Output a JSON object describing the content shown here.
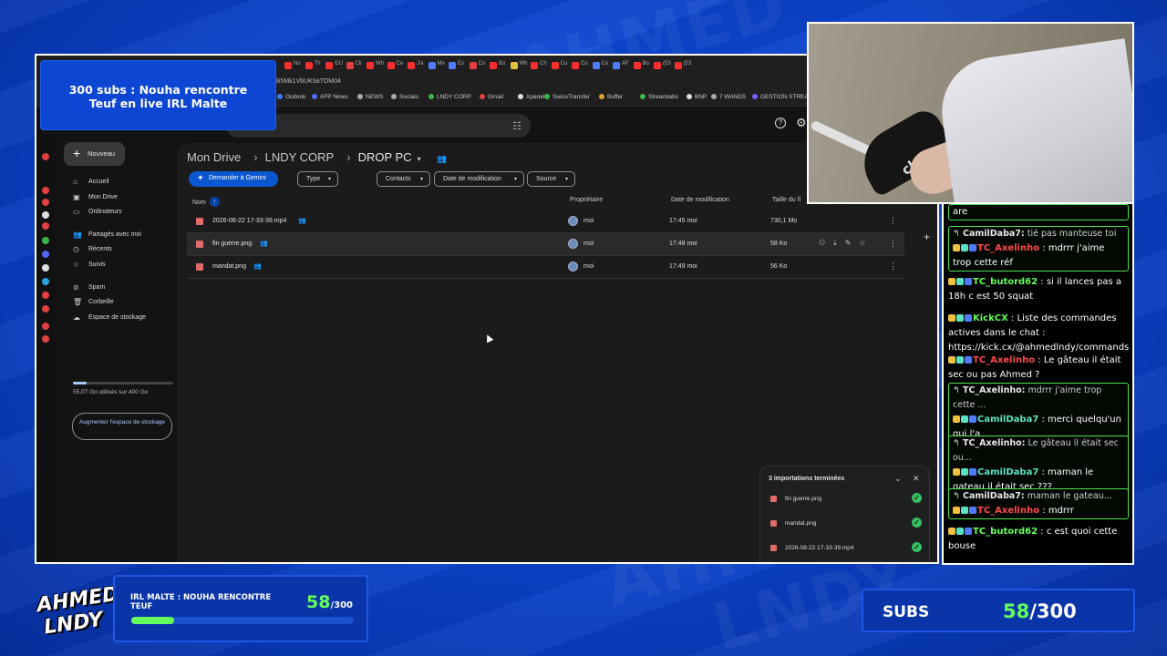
{
  "stream_title": "300 subs : Nouha rencontre Teuf en live IRL Malte",
  "browser": {
    "url_fragment": "8i5Mk1VbUK9aTOM04",
    "tabs": [
      "No",
      "Th",
      "GU",
      "Cli",
      "Wh",
      "Ce",
      "J'a",
      "Me",
      "Es",
      "Co",
      "Bo",
      "Wh",
      "Ch",
      "Cu",
      "Cu",
      "Co",
      "AF",
      "Bo",
      "(53",
      "(53"
    ],
    "bookmarks": [
      "Outlook",
      "AFP News",
      "NEWS",
      "Socials",
      "LNDY CORP",
      "Gmail",
      "Xpanel",
      "SwissTransfer",
      "Buffer",
      "Streamlabs",
      "BNP",
      "7 WANDS",
      "GESTION STREAM"
    ]
  },
  "drive": {
    "new_button": "Nouveau",
    "nav": [
      {
        "icon": "home-icon",
        "glyph": "⌂",
        "label": "Accueil"
      },
      {
        "icon": "drive-icon",
        "glyph": "▣",
        "label": "Mon Drive"
      },
      {
        "icon": "computer-icon",
        "glyph": "▭",
        "label": "Ordinateurs"
      },
      {
        "icon": "shared-icon",
        "glyph": "👥",
        "label": "Partagés avec moi"
      },
      {
        "icon": "recent-icon",
        "glyph": "◷",
        "label": "Récents"
      },
      {
        "icon": "star-icon",
        "glyph": "☆",
        "label": "Suivis"
      },
      {
        "icon": "spam-icon",
        "glyph": "⊘",
        "label": "Spam"
      },
      {
        "icon": "trash-icon",
        "glyph": "🗑",
        "label": "Corbeille"
      },
      {
        "icon": "cloud-icon",
        "glyph": "☁",
        "label": "Espace de stockage"
      }
    ],
    "storage_text": "55,07 Go utilisés sur 400 Go",
    "storage_used_fraction": 0.14,
    "upgrade_button": "Augmenter l'espace de stockage",
    "breadcrumb": [
      "Mon Drive",
      "LNDY CORP",
      "DROP PC"
    ],
    "gemini_button": "Demander à Gemini",
    "filters": [
      "Type",
      "Contacts",
      "Date de modification",
      "Source"
    ],
    "columns": {
      "name": "Nom",
      "owner": "Propriétaire",
      "modified": "Date de modification",
      "size": "Taille du fi"
    },
    "files": [
      {
        "name": "2026-08-22 17-33-39.mp4",
        "owner": "moi",
        "modified": "17:45 moi",
        "size": "730,1 Mo"
      },
      {
        "name": "fin guerre.png",
        "owner": "moi",
        "modified": "17:48 moi",
        "size": "58 Ko"
      },
      {
        "name": "mandat.png",
        "owner": "moi",
        "modified": "17:49 moi",
        "size": "56 Ko"
      }
    ],
    "upload_panel": {
      "title": "3 importations terminées",
      "items": [
        "fin guerre.png",
        "mandat.png",
        "2026-08-22 17-33-39.mp4"
      ]
    }
  },
  "webcam": {
    "brand_text": "clair."
  },
  "chat": [
    {
      "boxed": true,
      "partial": "are"
    },
    {
      "boxed": true,
      "reply_user": "CamilDaba7:",
      "reply_text": "tié pas manteuse toi",
      "user": "TC_Axelinho",
      "user_color": "red",
      "text": "mdrrr j'aime trop cette réf"
    },
    {
      "boxed": false,
      "user": "TC_butord62",
      "user_color": "green",
      "text": "si il lances pas a 18h c est 50 squat"
    },
    {
      "boxed": false,
      "user": "KickCX",
      "user_color": "green",
      "text": "Liste des commandes actives dans le chat : https://kick.cx/@ahmedlndy/commands"
    },
    {
      "boxed": false,
      "user": "TC_Axelinho",
      "user_color": "red",
      "text": "Le gâteau il était sec ou pas Ahmed ?"
    },
    {
      "boxed": true,
      "reply_user": "TC_Axelinho:",
      "reply_text": "mdrrr j'aime trop cette ...",
      "user": "CamilDaba7",
      "user_color": "teal",
      "text": "merci quelqu'un qui l'a"
    },
    {
      "boxed": true,
      "reply_user": "TC_Axelinho:",
      "reply_text": "Le gâteau il était sec ou...",
      "user": "CamilDaba7",
      "user_color": "teal",
      "text": "maman le gateau il était sec ???"
    },
    {
      "boxed": true,
      "reply_user": "CamilDaba7:",
      "reply_text": "maman le gateau...",
      "user": "TC_Axelinho",
      "user_color": "red",
      "text": "mdrrr"
    },
    {
      "boxed": false,
      "user": "TC_butord62",
      "user_color": "green",
      "text": "c est quoi cette bouse"
    }
  ],
  "goal": {
    "title": "IRL MALTE : NOUHA RENCONTRE TEUF",
    "current": "58",
    "total": "/300",
    "progress_fraction": 0.193
  },
  "subs": {
    "label": "SUBS",
    "current": "58",
    "total": "/300"
  },
  "logo": {
    "line1": "AHMED",
    "line2": "LNDY"
  }
}
